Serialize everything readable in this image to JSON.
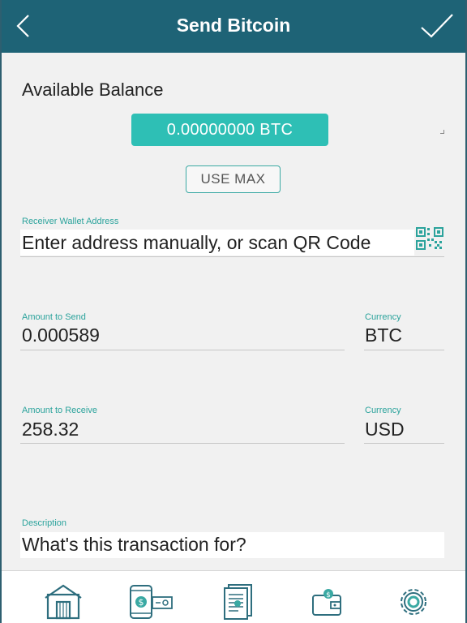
{
  "header": {
    "title": "Send Bitcoin",
    "bg_color": "#1e6376"
  },
  "balance": {
    "label": "Available Balance",
    "amount": "0.00000000 BTC",
    "use_max_label": "USE MAX",
    "accent_color": "#2ebfb5"
  },
  "receiver": {
    "label": "Receiver Wallet Address",
    "placeholder": "Enter address manually, or scan QR Code"
  },
  "send": {
    "amount_label": "Amount to Send",
    "amount_value": "0.000589",
    "currency_label": "Currency",
    "currency_value": "BTC"
  },
  "receive": {
    "amount_label": "Amount to Receive",
    "amount_value": "258.32",
    "currency_label": "Currency",
    "currency_value": "USD"
  },
  "description": {
    "label": "Description",
    "placeholder": "What's this transaction for?"
  },
  "tabbar": {
    "icons": [
      "home-icon",
      "send-payment-icon",
      "receipt-icon",
      "wallet-icon",
      "settings-gear-icon"
    ]
  }
}
